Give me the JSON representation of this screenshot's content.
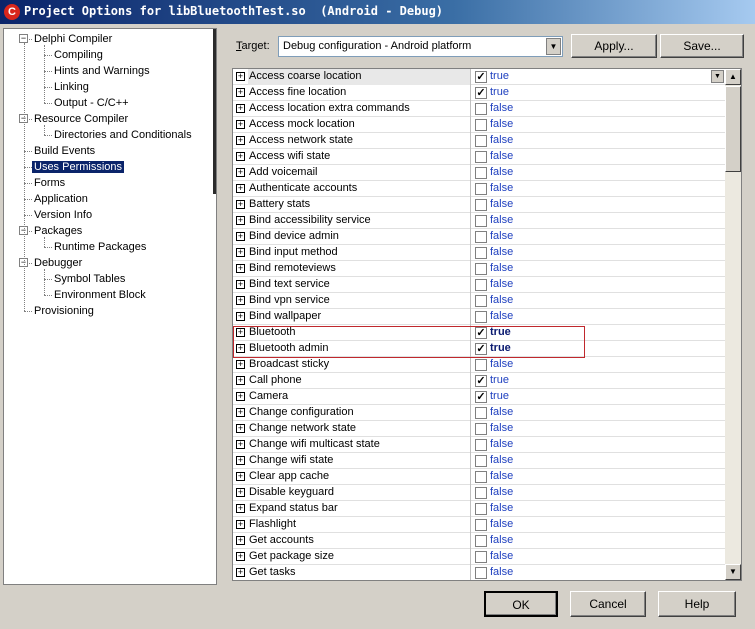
{
  "window": {
    "title": "Project Options for libBluetoothTest.so  (Android - Debug)",
    "icon_letter": "C"
  },
  "tree": {
    "items": [
      {
        "label": "Delphi Compiler",
        "level": 0,
        "toggle": "−"
      },
      {
        "label": "Compiling",
        "level": 1
      },
      {
        "label": "Hints and Warnings",
        "level": 1
      },
      {
        "label": "Linking",
        "level": 1
      },
      {
        "label": "Output - C/C++",
        "level": 1
      },
      {
        "label": "Resource Compiler",
        "level": 0,
        "toggle": "−"
      },
      {
        "label": "Directories and Conditionals",
        "level": 1
      },
      {
        "label": "Build Events",
        "level": 0
      },
      {
        "label": "Uses Permissions",
        "level": 0,
        "selected": true
      },
      {
        "label": "Forms",
        "level": 0
      },
      {
        "label": "Application",
        "level": 0
      },
      {
        "label": "Version Info",
        "level": 0
      },
      {
        "label": "Packages",
        "level": 0,
        "toggle": "−"
      },
      {
        "label": "Runtime Packages",
        "level": 1
      },
      {
        "label": "Debugger",
        "level": 0,
        "toggle": "−"
      },
      {
        "label": "Symbol Tables",
        "level": 1
      },
      {
        "label": "Environment Block",
        "level": 1
      },
      {
        "label": "Provisioning",
        "level": 0
      }
    ]
  },
  "target": {
    "label_prefix": "",
    "label_access": "T",
    "label_rest": "arget:",
    "value": "Debug configuration - Android platform",
    "apply_label": "Apply...",
    "save_label": "Save..."
  },
  "permissions": [
    {
      "name": "Access coarse location",
      "value": "true",
      "checked": true
    },
    {
      "name": "Access fine location",
      "value": "true",
      "checked": true
    },
    {
      "name": "Access location extra commands",
      "value": "false",
      "checked": false
    },
    {
      "name": "Access mock location",
      "value": "false",
      "checked": false
    },
    {
      "name": "Access network state",
      "value": "false",
      "checked": false
    },
    {
      "name": "Access wifi state",
      "value": "false",
      "checked": false
    },
    {
      "name": "Add voicemail",
      "value": "false",
      "checked": false
    },
    {
      "name": "Authenticate accounts",
      "value": "false",
      "checked": false
    },
    {
      "name": "Battery stats",
      "value": "false",
      "checked": false
    },
    {
      "name": "Bind accessibility service",
      "value": "false",
      "checked": false
    },
    {
      "name": "Bind device admin",
      "value": "false",
      "checked": false
    },
    {
      "name": "Bind input method",
      "value": "false",
      "checked": false
    },
    {
      "name": "Bind remoteviews",
      "value": "false",
      "checked": false
    },
    {
      "name": "Bind text service",
      "value": "false",
      "checked": false
    },
    {
      "name": "Bind vpn service",
      "value": "false",
      "checked": false
    },
    {
      "name": "Bind wallpaper",
      "value": "false",
      "checked": false
    },
    {
      "name": "Bluetooth",
      "value": "true",
      "checked": true,
      "bold": true
    },
    {
      "name": "Bluetooth admin",
      "value": "true",
      "checked": true,
      "bold": true
    },
    {
      "name": "Broadcast sticky",
      "value": "false",
      "checked": false
    },
    {
      "name": "Call phone",
      "value": "true",
      "checked": true
    },
    {
      "name": "Camera",
      "value": "true",
      "checked": true
    },
    {
      "name": "Change configuration",
      "value": "false",
      "checked": false
    },
    {
      "name": "Change network state",
      "value": "false",
      "checked": false
    },
    {
      "name": "Change wifi multicast state",
      "value": "false",
      "checked": false
    },
    {
      "name": "Change wifi state",
      "value": "false",
      "checked": false
    },
    {
      "name": "Clear app cache",
      "value": "false",
      "checked": false
    },
    {
      "name": "Disable keyguard",
      "value": "false",
      "checked": false
    },
    {
      "name": "Expand status bar",
      "value": "false",
      "checked": false
    },
    {
      "name": "Flashlight",
      "value": "false",
      "checked": false
    },
    {
      "name": "Get accounts",
      "value": "false",
      "checked": false
    },
    {
      "name": "Get package size",
      "value": "false",
      "checked": false
    },
    {
      "name": "Get tasks",
      "value": "false",
      "checked": false
    }
  ],
  "buttons": {
    "ok": "OK",
    "cancel": "Cancel",
    "help": "Help"
  },
  "colors": {
    "selection": "#0a246a",
    "highlight_box": "#c0282d",
    "value_text": "#1e3fbf"
  }
}
